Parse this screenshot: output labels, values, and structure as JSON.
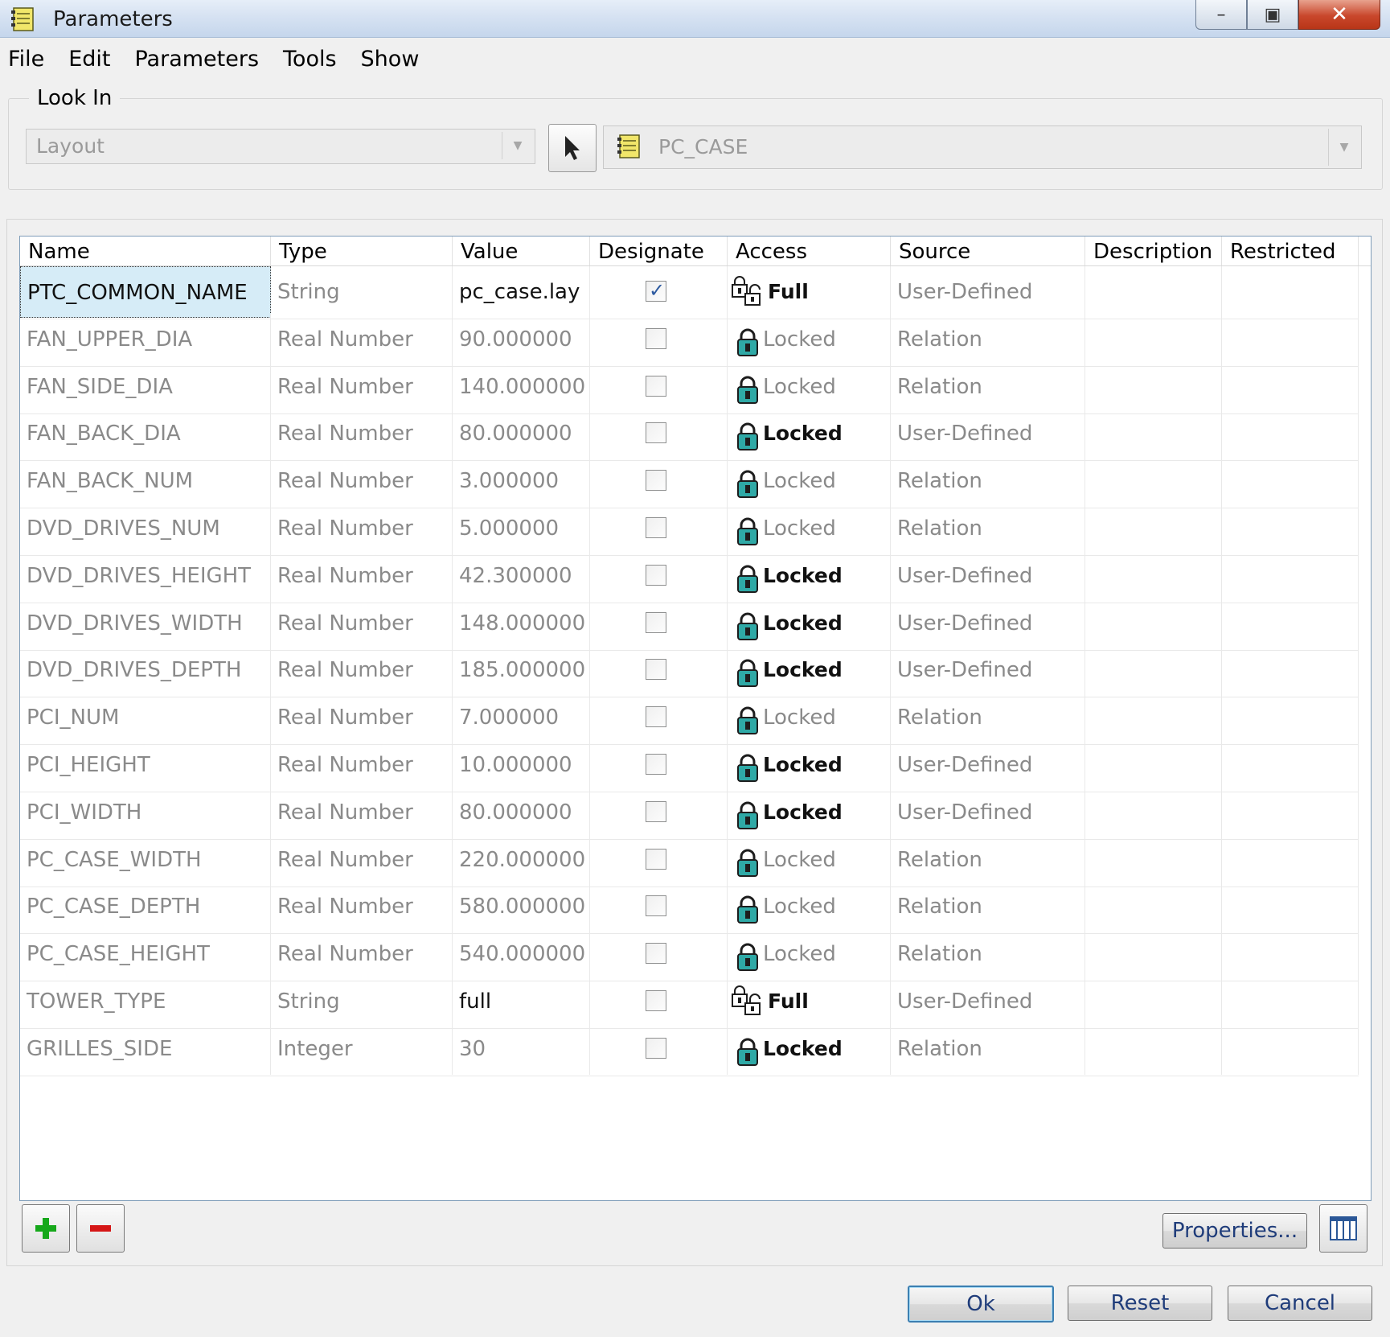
{
  "window": {
    "title": "Parameters"
  },
  "menu": [
    "File",
    "Edit",
    "Parameters",
    "Tools",
    "Show"
  ],
  "look_in": {
    "label": "Look In",
    "type_value": "Layout",
    "model_value": "PC_CASE"
  },
  "table": {
    "columns": [
      "Name",
      "Type",
      "Value",
      "Designate",
      "Access",
      "Source",
      "Description",
      "Restricted"
    ],
    "rows": [
      {
        "name": "PTC_COMMON_NAME",
        "type": "String",
        "value": "pc_case.lay",
        "designate": true,
        "access": "Full",
        "access_icon": "unlocked-lock-icon",
        "source": "User-Defined",
        "description": "",
        "restricted": "",
        "selected": true
      },
      {
        "name": "FAN_UPPER_DIA",
        "type": "Real Number",
        "value": "90.000000",
        "designate": false,
        "access": "Locked",
        "access_icon": "locked-icon",
        "source": "Relation",
        "description": "",
        "restricted": ""
      },
      {
        "name": "FAN_SIDE_DIA",
        "type": "Real Number",
        "value": "140.000000",
        "designate": false,
        "access": "Locked",
        "access_icon": "locked-icon",
        "source": "Relation",
        "description": "",
        "restricted": ""
      },
      {
        "name": "FAN_BACK_DIA",
        "type": "Real Number",
        "value": "80.000000",
        "designate": false,
        "access": "Locked",
        "access_icon": "locked-icon",
        "source": "User-Defined",
        "description": "",
        "restricted": "",
        "access_bold": true
      },
      {
        "name": "FAN_BACK_NUM",
        "type": "Real Number",
        "value": "3.000000",
        "designate": false,
        "access": "Locked",
        "access_icon": "locked-icon",
        "source": "Relation",
        "description": "",
        "restricted": ""
      },
      {
        "name": "DVD_DRIVES_NUM",
        "type": "Real Number",
        "value": "5.000000",
        "designate": false,
        "access": "Locked",
        "access_icon": "locked-icon",
        "source": "Relation",
        "description": "",
        "restricted": ""
      },
      {
        "name": "DVD_DRIVES_HEIGHT",
        "type": "Real Number",
        "value": "42.300000",
        "designate": false,
        "access": "Locked",
        "access_icon": "locked-icon",
        "source": "User-Defined",
        "description": "",
        "restricted": "",
        "access_bold": true
      },
      {
        "name": "DVD_DRIVES_WIDTH",
        "type": "Real Number",
        "value": "148.000000",
        "designate": false,
        "access": "Locked",
        "access_icon": "locked-icon",
        "source": "User-Defined",
        "description": "",
        "restricted": "",
        "access_bold": true
      },
      {
        "name": "DVD_DRIVES_DEPTH",
        "type": "Real Number",
        "value": "185.000000",
        "designate": false,
        "access": "Locked",
        "access_icon": "locked-icon",
        "source": "User-Defined",
        "description": "",
        "restricted": "",
        "access_bold": true
      },
      {
        "name": "PCI_NUM",
        "type": "Real Number",
        "value": "7.000000",
        "designate": false,
        "access": "Locked",
        "access_icon": "locked-icon",
        "source": "Relation",
        "description": "",
        "restricted": ""
      },
      {
        "name": "PCI_HEIGHT",
        "type": "Real Number",
        "value": "10.000000",
        "designate": false,
        "access": "Locked",
        "access_icon": "locked-icon",
        "source": "User-Defined",
        "description": "",
        "restricted": "",
        "access_bold": true
      },
      {
        "name": "PCI_WIDTH",
        "type": "Real Number",
        "value": "80.000000",
        "designate": false,
        "access": "Locked",
        "access_icon": "locked-icon",
        "source": "User-Defined",
        "description": "",
        "restricted": "",
        "access_bold": true
      },
      {
        "name": "PC_CASE_WIDTH",
        "type": "Real Number",
        "value": "220.000000",
        "designate": false,
        "access": "Locked",
        "access_icon": "locked-icon",
        "source": "Relation",
        "description": "",
        "restricted": ""
      },
      {
        "name": "PC_CASE_DEPTH",
        "type": "Real Number",
        "value": "580.000000",
        "designate": false,
        "access": "Locked",
        "access_icon": "locked-icon",
        "source": "Relation",
        "description": "",
        "restricted": ""
      },
      {
        "name": "PC_CASE_HEIGHT",
        "type": "Real Number",
        "value": "540.000000",
        "designate": false,
        "access": "Locked",
        "access_icon": "locked-icon",
        "source": "Relation",
        "description": "",
        "restricted": ""
      },
      {
        "name": "TOWER_TYPE",
        "type": "String",
        "value": "full",
        "designate": false,
        "access": "Full",
        "access_icon": "unlocked-lock-icon",
        "source": "User-Defined",
        "description": "",
        "restricted": ""
      },
      {
        "name": "GRILLES_SIDE",
        "type": "Integer",
        "value": "30",
        "designate": false,
        "access": "Locked",
        "access_icon": "locked-icon",
        "source": "Relation",
        "description": "",
        "restricted": "",
        "access_bold": true
      }
    ]
  },
  "toolbar": {
    "properties_label": "Properties..."
  },
  "footer": {
    "ok_label": "Ok",
    "reset_label": "Reset",
    "cancel_label": "Cancel"
  },
  "colors": {
    "selection": "#d6ecf7",
    "lock_teal": "#2fa9a6",
    "add_green": "#16a81b",
    "remove_red": "#d51616"
  }
}
